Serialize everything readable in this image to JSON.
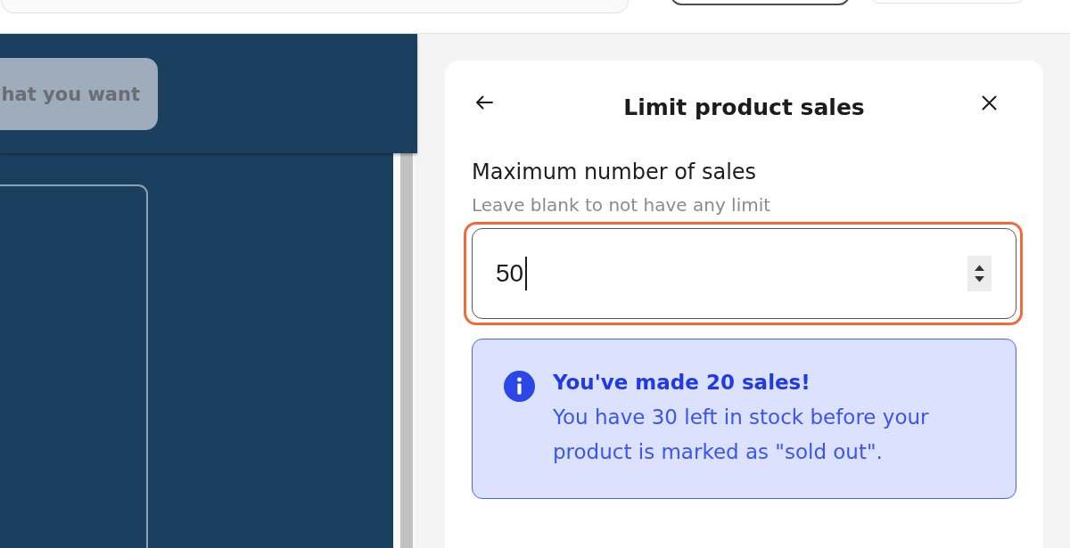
{
  "left_panel": {
    "button": {
      "label": "hat you want"
    }
  },
  "dialog": {
    "title": "Limit product sales",
    "field": {
      "label": "Maximum number of sales",
      "hint": "Leave blank to not have any limit",
      "value": "50",
      "focused": true,
      "highlighted": true
    },
    "notice": {
      "title": "You've made 20 sales!",
      "message": "You have 30 left in stock before your product is marked as \"sold out\"."
    }
  }
}
